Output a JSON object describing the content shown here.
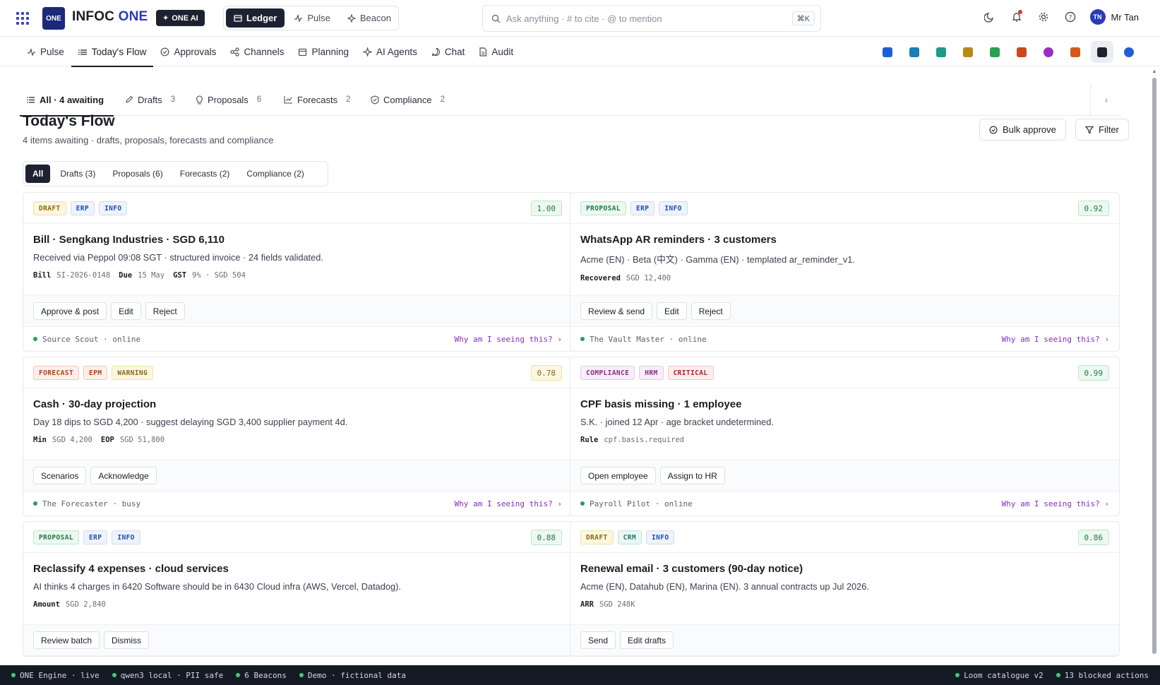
{
  "app": {
    "logo_text": "ONE",
    "brand_main": "INFOC",
    "brand_accent": "ONE",
    "one_ai_label": "ONE AI",
    "switcher": [
      {
        "label": "Ledger",
        "icon": "ledger-icon",
        "active": true
      },
      {
        "label": "Pulse",
        "icon": "pulse-icon",
        "active": false
      },
      {
        "label": "Beacon",
        "icon": "beacon-icon",
        "active": false
      }
    ],
    "search_placeholder": "Ask anything · # to cite · @ to mention",
    "search_shortcut": "⌘K",
    "user_initials": "TN",
    "user_name": "Mr Tan"
  },
  "nav": {
    "tabs": [
      {
        "label": "Pulse",
        "icon": "pulse-icon"
      },
      {
        "label": "Today's Flow",
        "icon": "list-icon",
        "active": true
      },
      {
        "label": "Approvals",
        "icon": "check-circle-icon"
      },
      {
        "label": "Channels",
        "icon": "share-icon"
      },
      {
        "label": "Planning",
        "icon": "calendar-icon"
      },
      {
        "label": "AI Agents",
        "icon": "sparkle-icon"
      },
      {
        "label": "Chat",
        "icon": "chat-icon"
      },
      {
        "label": "Audit",
        "icon": "document-icon"
      }
    ],
    "app_icons": [
      {
        "name": "home-icon",
        "color": "#1f5fd6"
      },
      {
        "name": "book-icon",
        "color": "#1a7fb8"
      },
      {
        "name": "people-icon",
        "color": "#1f9a8a"
      },
      {
        "name": "card-icon",
        "color": "#b88a14"
      },
      {
        "name": "box-icon",
        "color": "#2aa050"
      },
      {
        "name": "briefcase-icon",
        "color": "#c84a1a"
      },
      {
        "name": "person-circle-icon",
        "color": "#9a2cc2"
      },
      {
        "name": "chart-icon",
        "color": "#d45a1a"
      },
      {
        "name": "ai-sparkle-icon",
        "color": "#1e2230"
      },
      {
        "name": "compass-icon",
        "color": "#1f5fd6"
      }
    ]
  },
  "subtabs": [
    {
      "label": "All · 4 awaiting",
      "count": "",
      "icon": "list-icon",
      "active": true
    },
    {
      "label": "Drafts",
      "count": "3",
      "icon": "pencil-icon"
    },
    {
      "label": "Proposals",
      "count": "6",
      "icon": "bulb-icon"
    },
    {
      "label": "Forecasts",
      "count": "2",
      "icon": "trend-icon"
    },
    {
      "label": "Compliance",
      "count": "2",
      "icon": "shield-icon"
    }
  ],
  "page": {
    "title": "Today's Flow",
    "subtitle": "4 items awaiting · drafts, proposals, forecasts and compliance",
    "bulk_approve": "Bulk approve",
    "filter": "Filter"
  },
  "filter_chips": [
    {
      "label": "All",
      "active": true
    },
    {
      "label": "Drafts (3)"
    },
    {
      "label": "Proposals (6)"
    },
    {
      "label": "Forecasts (2)"
    },
    {
      "label": "Compliance (2)"
    }
  ],
  "cards": [
    {
      "badges": [
        {
          "text": "DRAFT",
          "fg": "#8a6a10",
          "bg": "#fdf6e0",
          "border": "#f1e2a8"
        },
        {
          "text": "ERP",
          "fg": "#1f4fb0",
          "bg": "#eef3fc",
          "border": "#cfdcf5"
        },
        {
          "text": "INFO",
          "fg": "#1f4fb0",
          "bg": "#eef3fc",
          "border": "#cfdcf5"
        }
      ],
      "score": "1.00",
      "score_fg": "#1f7a4a",
      "score_bg": "#ecf8f0",
      "score_border": "#bfe6cc",
      "title": "Bill · Sengkang Industries · SGD 6,110",
      "desc": "Received via Peppol 09:08 SGT · structured invoice · 24 fields validated.",
      "meta": [
        {
          "k": "Bill",
          "v": "SI-2026-0148"
        },
        {
          "k": "Due",
          "v": "15 May"
        },
        {
          "k": "GST",
          "v": "9% · SGD 504"
        }
      ],
      "actions": [
        "Approve & post",
        "Edit",
        "Reject"
      ],
      "agent": "Source Scout · online",
      "why": "Why am I seeing this? ›"
    },
    {
      "badges": [
        {
          "text": "PROPOSAL",
          "fg": "#1f7a4a",
          "bg": "#ecf8f0",
          "border": "#bfe6cc"
        },
        {
          "text": "ERP",
          "fg": "#1f4fb0",
          "bg": "#eef3fc",
          "border": "#cfdcf5"
        },
        {
          "text": "INFO",
          "fg": "#1f4fb0",
          "bg": "#eef3fc",
          "border": "#cfdcf5"
        }
      ],
      "score": "0.92",
      "score_fg": "#1f7a4a",
      "score_bg": "#ecf8f0",
      "score_border": "#bfe6cc",
      "title": "WhatsApp AR reminders · 3 customers",
      "desc": "Acme (EN) · Beta (中文) · Gamma (EN) · templated ar_reminder_v1.",
      "meta": [
        {
          "k": "Recovered",
          "v": "SGD 12,400"
        }
      ],
      "actions": [
        "Review & send",
        "Edit",
        "Reject"
      ],
      "agent": "The Vault Master · online",
      "why": "Why am I seeing this? ›"
    },
    {
      "badges": [
        {
          "text": "FORECAST",
          "fg": "#b0401a",
          "bg": "#fdf0ea",
          "border": "#f3c9b5"
        },
        {
          "text": "EPM",
          "fg": "#b0401a",
          "bg": "#fdf0ea",
          "border": "#f3c9b5"
        },
        {
          "text": "WARNING",
          "fg": "#8a6a10",
          "bg": "#fdf6e0",
          "border": "#f1e2a8"
        }
      ],
      "score": "0.78",
      "score_fg": "#8a6a10",
      "score_bg": "#fdf6e0",
      "score_border": "#f1e2a8",
      "title": "Cash · 30-day projection",
      "desc": "Day 18 dips to SGD 4,200 · suggest delaying SGD 3,400 supplier payment 4d.",
      "meta": [
        {
          "k": "Min",
          "v": "SGD 4,200"
        },
        {
          "k": "EOP",
          "v": "SGD 51,800"
        }
      ],
      "actions": [
        "Scenarios",
        "Acknowledge"
      ],
      "agent": "The Forecaster · busy",
      "why": "Why am I seeing this? ›"
    },
    {
      "badges": [
        {
          "text": "COMPLIANCE",
          "fg": "#8a2c8a",
          "bg": "#f8eefa",
          "border": "#e6c8ec"
        },
        {
          "text": "HRM",
          "fg": "#8a2c8a",
          "bg": "#f8eefa",
          "border": "#e6c8ec"
        },
        {
          "text": "CRITICAL",
          "fg": "#b02020",
          "bg": "#fdeeee",
          "border": "#f3c4c4"
        }
      ],
      "score": "0.99",
      "score_fg": "#1f7a4a",
      "score_bg": "#ecf8f0",
      "score_border": "#bfe6cc",
      "title": "CPF basis missing · 1 employee",
      "desc": "S.K. · joined 12 Apr · age bracket undetermined.",
      "meta": [
        {
          "k": "Rule",
          "v": "cpf.basis.required"
        }
      ],
      "actions": [
        "Open employee",
        "Assign to HR"
      ],
      "agent": "Payroll Pilot · online",
      "why": "Why am I seeing this? ›"
    },
    {
      "badges": [
        {
          "text": "PROPOSAL",
          "fg": "#1f7a4a",
          "bg": "#ecf8f0",
          "border": "#bfe6cc"
        },
        {
          "text": "ERP",
          "fg": "#1f4fb0",
          "bg": "#eef3fc",
          "border": "#cfdcf5"
        },
        {
          "text": "INFO",
          "fg": "#1f4fb0",
          "bg": "#eef3fc",
          "border": "#cfdcf5"
        }
      ],
      "score": "0.88",
      "score_fg": "#1f7a4a",
      "score_bg": "#ecf8f0",
      "score_border": "#bfe6cc",
      "title": "Reclassify 4 expenses · cloud services",
      "desc": "AI thinks 4 charges in 6420 Software should be in 6430 Cloud infra (AWS, Vercel, Datadog).",
      "meta": [
        {
          "k": "Amount",
          "v": "SGD 2,840"
        }
      ],
      "actions": [
        "Review batch",
        "Dismiss"
      ],
      "agent": "",
      "why": ""
    },
    {
      "badges": [
        {
          "text": "DRAFT",
          "fg": "#8a6a10",
          "bg": "#fdf6e0",
          "border": "#f1e2a8"
        },
        {
          "text": "CRM",
          "fg": "#1f7a6a",
          "bg": "#ebf7f5",
          "border": "#bfe3dc"
        },
        {
          "text": "INFO",
          "fg": "#1f4fb0",
          "bg": "#eef3fc",
          "border": "#cfdcf5"
        }
      ],
      "score": "0.86",
      "score_fg": "#1f7a4a",
      "score_bg": "#ecf8f0",
      "score_border": "#bfe6cc",
      "title": "Renewal email · 3 customers (90-day notice)",
      "desc": "Acme (EN), Datahub (EN), Marina (EN). 3 annual contracts up Jul 2026.",
      "meta": [
        {
          "k": "ARR",
          "v": "SGD 248K"
        }
      ],
      "actions": [
        "Send",
        "Edit drafts"
      ],
      "agent": "",
      "why": ""
    }
  ],
  "status": {
    "left": [
      "ONE Engine · live",
      "qwen3 local · PII safe",
      "6 Beacons",
      "Demo · fictional data"
    ],
    "right": [
      "Loom catalogue v2",
      "13 blocked actions"
    ]
  }
}
